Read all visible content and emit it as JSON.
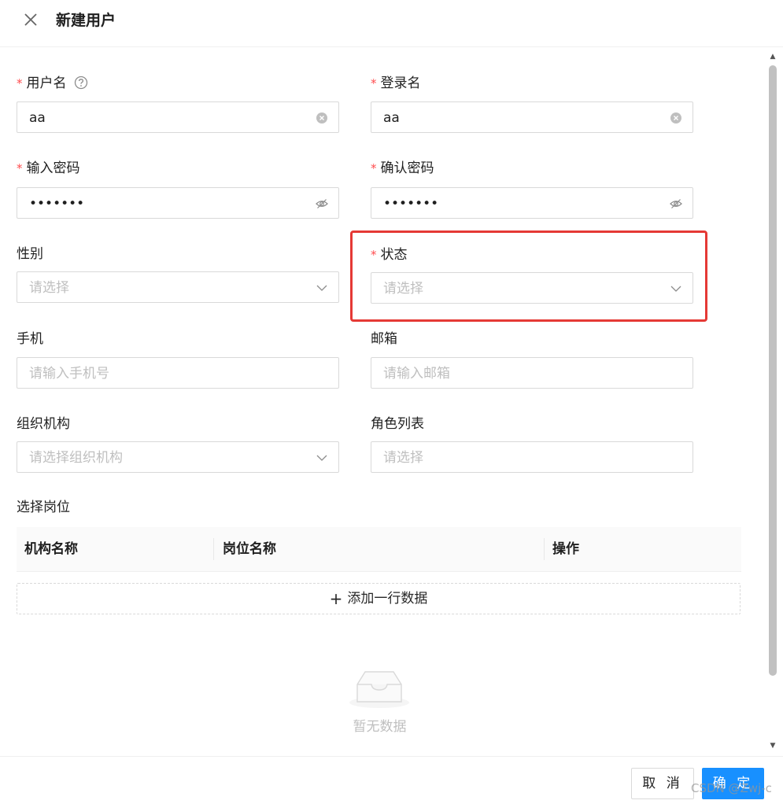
{
  "dialog": {
    "title": "新建用户"
  },
  "form": {
    "username": {
      "label": "用户名",
      "required": true,
      "value": "aa",
      "help_icon": "question-circle-icon",
      "suffix_icon": "clear-circle-icon"
    },
    "login_name": {
      "label": "登录名",
      "required": true,
      "value": "aa",
      "suffix_icon": "clear-circle-icon"
    },
    "password": {
      "label": "输入密码",
      "required": true,
      "masked_value": "•••••••",
      "suffix_icon": "eye-invisible-icon"
    },
    "confirm_password": {
      "label": "确认密码",
      "required": true,
      "masked_value": "•••••••",
      "suffix_icon": "eye-invisible-icon"
    },
    "gender": {
      "label": "性别",
      "placeholder": "请选择",
      "suffix_icon": "chevron-down-icon"
    },
    "status": {
      "label": "状态",
      "required": true,
      "placeholder": "请选择",
      "suffix_icon": "chevron-down-icon"
    },
    "phone": {
      "label": "手机",
      "placeholder": "请输入手机号"
    },
    "email": {
      "label": "邮箱",
      "placeholder": "请输入邮箱"
    },
    "org": {
      "label": "组织机构",
      "placeholder": "请选择组织机构",
      "suffix_icon": "chevron-down-icon"
    },
    "roles": {
      "label": "角色列表",
      "placeholder": "请选择"
    }
  },
  "positions": {
    "label": "选择岗位",
    "columns": [
      "机构名称",
      "岗位名称",
      "操作"
    ],
    "add_row_label": "添加一行数据",
    "empty_text": "暂无数据"
  },
  "footer": {
    "cancel_label": "取 消",
    "ok_label": "确 定"
  },
  "watermark": "CSDN @Zwj-c",
  "colors": {
    "primary": "#1890ff",
    "required": "#ff4d4f",
    "highlight": "#e53935"
  }
}
